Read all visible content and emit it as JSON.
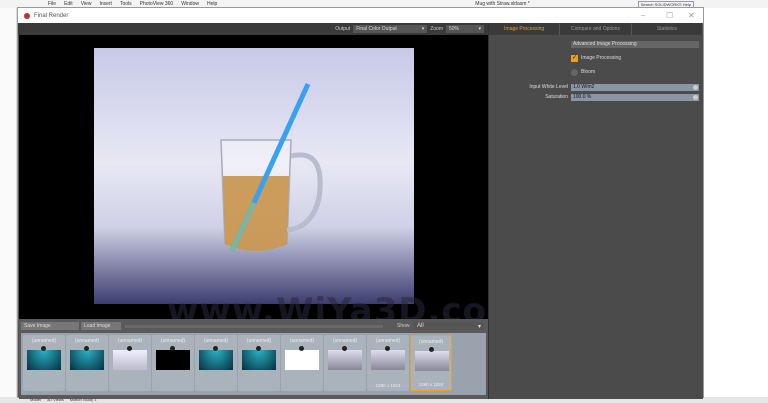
{
  "host": {
    "menu": [
      "File",
      "Edit",
      "View",
      "Insert",
      "Tools",
      "PhotoView 360",
      "Window",
      "Help"
    ],
    "doc_title": "Mug with Straw.sldasm *",
    "search_placeholder": "Search SOLIDWORKS Help",
    "bottom_tabs": [
      "Model",
      "3D Views",
      "Motion Study 1"
    ]
  },
  "window": {
    "title": "Final Render"
  },
  "toolbar": {
    "output_label": "Output",
    "output_value": "Final Color Output",
    "zoom_label": "Zoom",
    "zoom_value": "50%"
  },
  "panel": {
    "tabs": [
      "Image Processing",
      "Compare and Options",
      "Statistics"
    ],
    "active_tab": "Image Processing",
    "section": "Advanced Image Processing",
    "image_processing_label": "Image Processing",
    "image_processing_checked": true,
    "bloom_label": "Bloom",
    "bloom_checked": false,
    "white_level_label": "Input White Level",
    "white_level_value": "1.0 W/m2",
    "saturation_label": "Saturation",
    "saturation_value": "100.0 %"
  },
  "bottom": {
    "save_label": "Save Image",
    "load_label": "Load Image",
    "show_label": "Show",
    "show_value": "All"
  },
  "thumbnails": [
    {
      "name": "(unnamed)",
      "kind": "teal",
      "res": ""
    },
    {
      "name": "(unnamed)",
      "kind": "teal",
      "res": ""
    },
    {
      "name": "(unnamed)",
      "kind": "light",
      "res": ""
    },
    {
      "name": "(unnamed)",
      "kind": "black",
      "res": ""
    },
    {
      "name": "(unnamed)",
      "kind": "teal",
      "res": ""
    },
    {
      "name": "(unnamed)",
      "kind": "teal",
      "res": ""
    },
    {
      "name": "(unnamed)",
      "kind": "white",
      "res": ""
    },
    {
      "name": "(unnamed)",
      "kind": "mug",
      "res": ""
    },
    {
      "name": "(unnamed)",
      "kind": "mug",
      "res": "1280 x 1024"
    },
    {
      "name": "(unnamed)",
      "kind": "mug",
      "res": "1280 x 1024",
      "active": true
    }
  ],
  "watermark": "www.WiYa3D.com",
  "colors": {
    "accent": "#e8a020",
    "panel": "#4b4b4b",
    "field": "#8b96a4"
  }
}
